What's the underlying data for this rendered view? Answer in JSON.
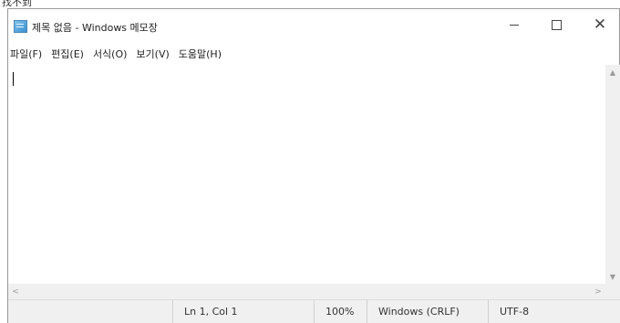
{
  "fragment": "找不到",
  "window": {
    "title": "제목 없음 - Windows 메모장"
  },
  "menu": [
    {
      "label": "파일(F)"
    },
    {
      "label": "편집(E)"
    },
    {
      "label": "서식(O)"
    },
    {
      "label": "보기(V)"
    },
    {
      "label": "도움말(H)"
    }
  ],
  "editor": {
    "content": ""
  },
  "status": {
    "position": "Ln 1, Col 1",
    "zoom": "100%",
    "line_ending": "Windows (CRLF)",
    "encoding": "UTF-8"
  },
  "icons": {
    "app": "notepad-icon",
    "minimize": "minimize-icon",
    "maximize": "maximize-icon",
    "close": "close-icon"
  }
}
